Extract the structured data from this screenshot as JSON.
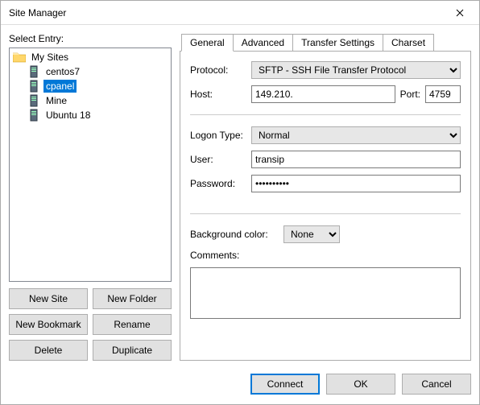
{
  "window": {
    "title": "Site Manager"
  },
  "left": {
    "label": "Select Entry:",
    "folder": "My Sites",
    "sites": [
      {
        "name": "centos7",
        "selected": false
      },
      {
        "name": "cpanel",
        "selected": true
      },
      {
        "name": "Mine",
        "selected": false
      },
      {
        "name": "Ubuntu 18",
        "selected": false
      }
    ],
    "buttons": {
      "new_site": "New Site",
      "new_folder": "New Folder",
      "new_bookmark": "New Bookmark",
      "rename": "Rename",
      "delete": "Delete",
      "duplicate": "Duplicate"
    }
  },
  "tabs": {
    "general": "General",
    "advanced": "Advanced",
    "transfer": "Transfer Settings",
    "charset": "Charset"
  },
  "general": {
    "protocol_label": "Protocol:",
    "protocol_value": "SFTP - SSH File Transfer Protocol",
    "host_label": "Host:",
    "host_value": "149.210.",
    "port_label": "Port:",
    "port_value": "4759",
    "logon_label": "Logon Type:",
    "logon_value": "Normal",
    "user_label": "User:",
    "user_value": "transip",
    "password_label": "Password:",
    "password_value": "••••••••••",
    "bgcolor_label": "Background color:",
    "bgcolor_value": "None",
    "comments_label": "Comments:",
    "comments_value": ""
  },
  "footer": {
    "connect": "Connect",
    "ok": "OK",
    "cancel": "Cancel"
  }
}
